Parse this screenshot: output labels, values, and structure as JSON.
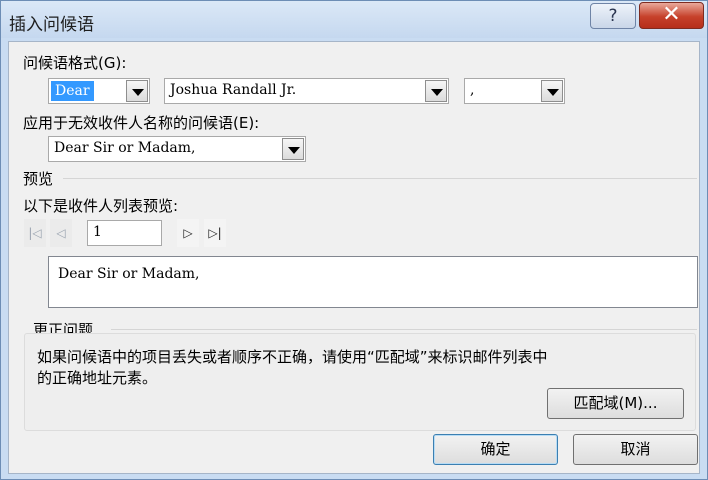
{
  "window": {
    "title": "插入问候语",
    "help_glyph": "?",
    "close_glyph": "✕"
  },
  "greeting_format": {
    "label": "问候语格式(G):",
    "salutation": "Dear",
    "name_format": "Joshua Randall Jr.",
    "punctuation": ","
  },
  "invalid_recipient": {
    "label": "应用于无效收件人名称的问候语(E):",
    "value": "Dear Sir or Madam,"
  },
  "preview": {
    "section_label": "预览",
    "list_label": "以下是收件人列表预览:",
    "record": "1",
    "text": "Dear Sir or Madam,"
  },
  "correct_problems": {
    "label": "更正问题",
    "description_line1": "如果问候语中的项目丢失或者顺序不正确，请使用“匹配域”来标识邮件列表中",
    "description_line2": "的正确地址元素。",
    "match_fields_button": "匹配域(M)..."
  },
  "buttons": {
    "ok": "确定",
    "cancel": "取消"
  },
  "colors": {
    "selection": "#3399ff",
    "close": "#c6412b",
    "frame": "#c9dcf2"
  }
}
